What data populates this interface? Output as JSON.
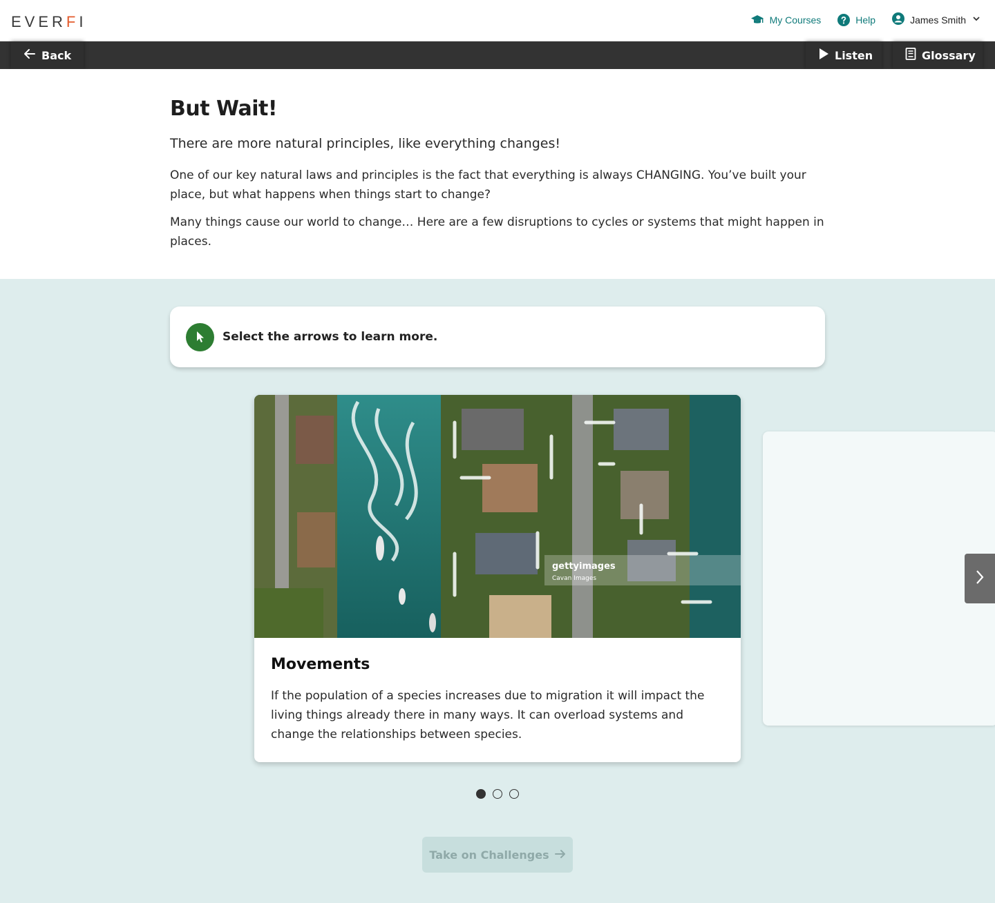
{
  "header": {
    "logo_left": "EVER",
    "logo_accent": "F",
    "logo_right": "I",
    "my_courses_label": "My Courses",
    "help_label": "Help",
    "user_name": "James Smith"
  },
  "toolbar": {
    "back_label": "Back",
    "listen_label": "Listen",
    "glossary_label": "Glossary"
  },
  "intro": {
    "title": "But Wait!",
    "subtitle": "There are more natural principles, like everything changes!",
    "paragraph1": "One of our key natural laws and principles is the fact that everything is always CHANGING. You’ve built your place, but what happens when things start to change?",
    "paragraph2": "Many things cause our world to change… Here are a few disruptions to cycles or systems that might happen in places."
  },
  "instruction": {
    "text": "Select the arrows to learn more."
  },
  "carousel": {
    "current_slide": 1,
    "total_slides": 3,
    "card": {
      "image_watermark": "gettyimages",
      "image_credit": "Cavan Images",
      "title": "Movements",
      "body": "If the population of a species increases due to migration it will impact the living things already there in many ways. It can overload systems and change the relationships between species."
    }
  },
  "cta": {
    "label": "Take on Challenges",
    "enabled": false
  },
  "colors": {
    "brand_accent": "#e35b2c",
    "link_teal": "#0f7a7a",
    "toolbar_bg": "#333333",
    "lower_bg": "#deeded",
    "instruction_badge": "#2d7d32"
  },
  "icons": {
    "back": "arrow-left-icon",
    "listen": "play-icon",
    "glossary": "book-icon",
    "my_courses": "graduation-cap-icon",
    "help": "question-circle-icon",
    "user": "user-circle-icon",
    "user_menu": "chevron-down-icon",
    "instruction": "cursor-pointer-icon",
    "next": "chevron-right-icon",
    "cta": "arrow-right-icon"
  }
}
